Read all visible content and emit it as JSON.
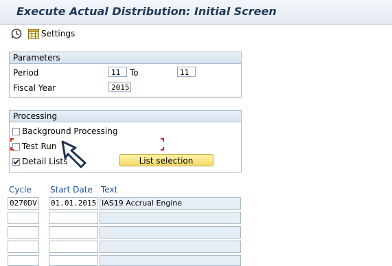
{
  "window": {
    "title": "Execute Actual Distribution: Initial Screen"
  },
  "toolbar": {
    "execute_icon": "execute-clock-icon",
    "settings_icon": "table-settings-icon",
    "settings_label": "Settings"
  },
  "parameters": {
    "title": "Parameters",
    "period_label": "Period",
    "period_from": "11",
    "to_label": "To",
    "period_to": "11",
    "fiscal_year_label": "Fiscal Year",
    "fiscal_year": "2015"
  },
  "processing": {
    "title": "Processing",
    "background_label": "Background Processing",
    "background_checked": false,
    "test_run_label": "Test Run",
    "test_run_checked": false,
    "detail_lists_label": "Detail Lists",
    "detail_lists_checked": true,
    "list_selection_label": "List selection"
  },
  "table": {
    "headers": {
      "cycle": "Cycle",
      "start_date": "Start Date",
      "text": "Text"
    },
    "rows": [
      {
        "cycle": "0270DV",
        "start_date": "01.01.2015",
        "text": "IAS19 Accrual Engine"
      },
      {
        "cycle": "",
        "start_date": "",
        "text": ""
      },
      {
        "cycle": "",
        "start_date": "",
        "text": ""
      },
      {
        "cycle": "",
        "start_date": "",
        "text": ""
      },
      {
        "cycle": "",
        "start_date": "",
        "text": ""
      }
    ]
  },
  "colors": {
    "header_bg": "#e3eaf2",
    "title_text": "#1f3a5a",
    "group_border": "#a7bcd2",
    "button_yellow": "#f5d96a",
    "column_header": "#1a4fa0",
    "focus_marker": "#d42020"
  }
}
